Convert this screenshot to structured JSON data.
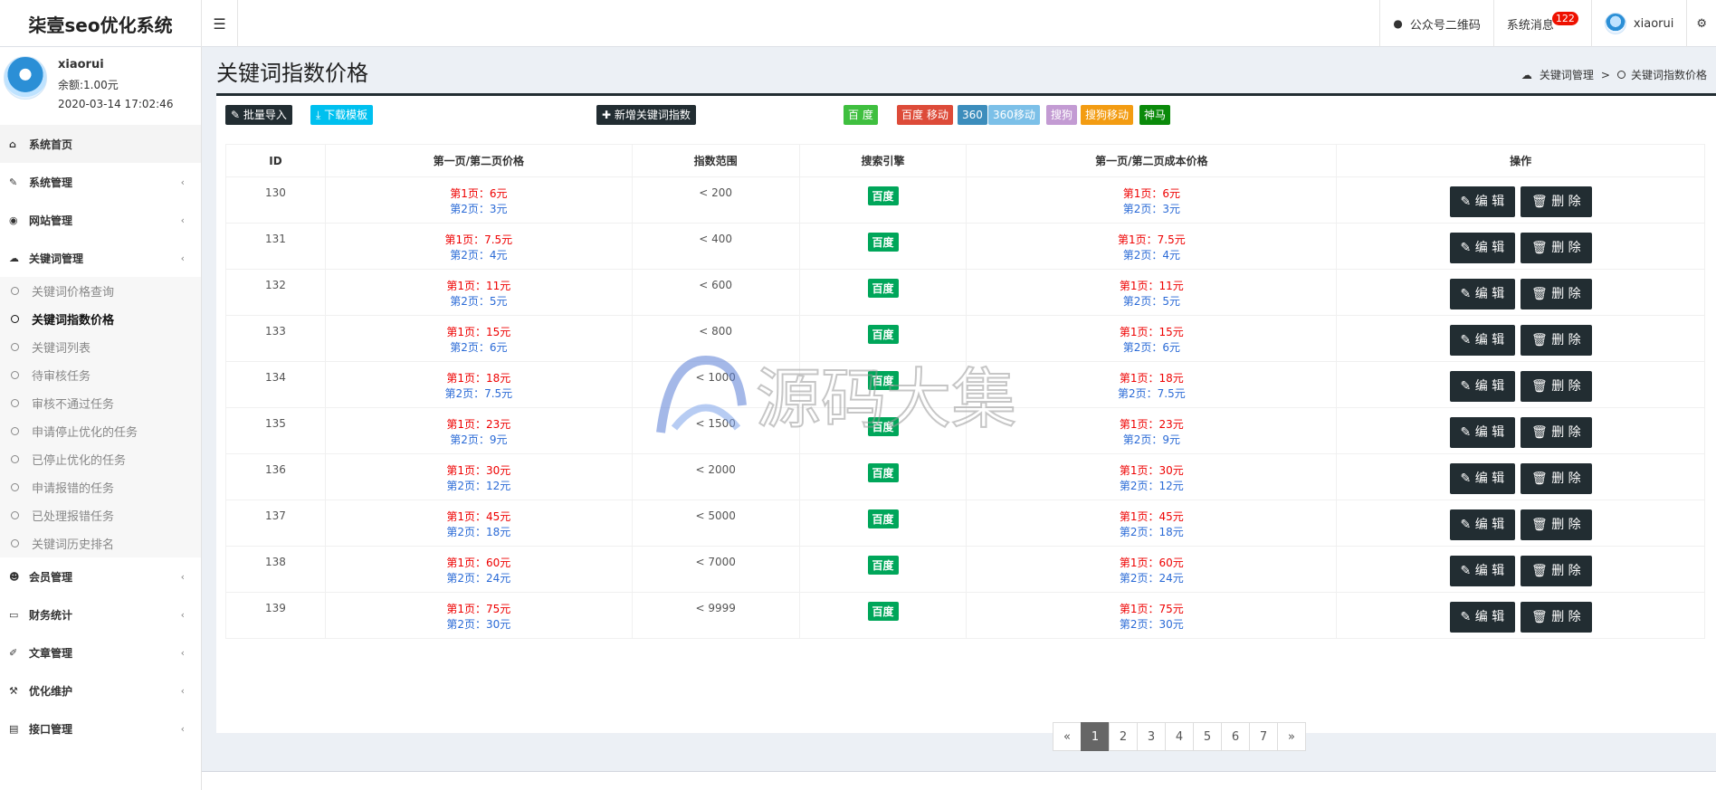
{
  "header": {
    "logo": "柒壹seo优化系统",
    "toggle_icon": "☰",
    "qr_label": "公众号二维码",
    "messages_label": "系统消息",
    "messages_count": "122",
    "username": "xiaorui",
    "gear_icon": "⚙"
  },
  "user": {
    "name": "xiaorui",
    "balance": "余额:1.00元",
    "datetime": "2020-03-14 17:02:46"
  },
  "sidebar": {
    "items": [
      {
        "label": "系统首页",
        "icon": "home-icon"
      },
      {
        "label": "系统管理",
        "icon": "wrench-icon"
      },
      {
        "label": "网站管理",
        "icon": "circle-icon"
      },
      {
        "label": "关键词管理",
        "icon": "cloud-icon"
      }
    ],
    "sub_items": [
      "关键词价格查询",
      "关键词指数价格",
      "关键词列表",
      "待审核任务",
      "审核不通过任务",
      "申请停止优化的任务",
      "已停止优化的任务",
      "申请报错的任务",
      "已处理报错任务",
      "关键词历史排名"
    ],
    "items_after": [
      {
        "label": "会员管理",
        "icon": "users-icon"
      },
      {
        "label": "财务统计",
        "icon": "card-icon"
      },
      {
        "label": "文章管理",
        "icon": "edit-icon"
      },
      {
        "label": "优化维护",
        "icon": "hammer-icon"
      },
      {
        "label": "接口管理",
        "icon": "book-icon"
      }
    ]
  },
  "page": {
    "title": "关键词指数价格",
    "breadcrumb_parent": "关键词管理",
    "breadcrumb_sep": ">",
    "breadcrumb_current": "关键词指数价格"
  },
  "toolbar": {
    "import_label": "批量导入",
    "download_label": "下载模板",
    "add_label": "新增关键词指数",
    "engines": [
      {
        "label": "百 度",
        "color": "#3fbf3f"
      },
      {
        "label": "百度 移动",
        "color": "#dd4b39"
      },
      {
        "label": "360",
        "color": "#3c8dbc"
      },
      {
        "label": "360移动",
        "color": "#7cc0e8"
      },
      {
        "label": "搜狗",
        "color": "#c39bd3"
      },
      {
        "label": "搜狗移动",
        "color": "#f39c12"
      },
      {
        "label": "神马",
        "color": "#0a8a0a"
      }
    ]
  },
  "table": {
    "headers": [
      "ID",
      "第一页/第二页价格",
      "指数范围",
      "搜索引擎",
      "第一页/第二页成本价格",
      "操作"
    ],
    "edit_label": "编 辑",
    "delete_label": "删 除",
    "rows": [
      {
        "id": "130",
        "p1": "第1页：6元",
        "p2": "第2页：3元",
        "range": "< 200",
        "engine": "百度",
        "c1": "第1页：6元",
        "c2": "第2页：3元"
      },
      {
        "id": "131",
        "p1": "第1页：7.5元",
        "p2": "第2页：4元",
        "range": "< 400",
        "engine": "百度",
        "c1": "第1页：7.5元",
        "c2": "第2页：4元"
      },
      {
        "id": "132",
        "p1": "第1页：11元",
        "p2": "第2页：5元",
        "range": "< 600",
        "engine": "百度",
        "c1": "第1页：11元",
        "c2": "第2页：5元"
      },
      {
        "id": "133",
        "p1": "第1页：15元",
        "p2": "第2页：6元",
        "range": "< 800",
        "engine": "百度",
        "c1": "第1页：15元",
        "c2": "第2页：6元"
      },
      {
        "id": "134",
        "p1": "第1页：18元",
        "p2": "第2页：7.5元",
        "range": "< 1000",
        "engine": "百度",
        "c1": "第1页：18元",
        "c2": "第2页：7.5元"
      },
      {
        "id": "135",
        "p1": "第1页：23元",
        "p2": "第2页：9元",
        "range": "< 1500",
        "engine": "百度",
        "c1": "第1页：23元",
        "c2": "第2页：9元"
      },
      {
        "id": "136",
        "p1": "第1页：30元",
        "p2": "第2页：12元",
        "range": "< 2000",
        "engine": "百度",
        "c1": "第1页：30元",
        "c2": "第2页：12元"
      },
      {
        "id": "137",
        "p1": "第1页：45元",
        "p2": "第2页：18元",
        "range": "< 5000",
        "engine": "百度",
        "c1": "第1页：45元",
        "c2": "第2页：18元"
      },
      {
        "id": "138",
        "p1": "第1页：60元",
        "p2": "第2页：24元",
        "range": "< 7000",
        "engine": "百度",
        "c1": "第1页：60元",
        "c2": "第2页：24元"
      },
      {
        "id": "139",
        "p1": "第1页：75元",
        "p2": "第2页：30元",
        "range": "< 9999",
        "engine": "百度",
        "c1": "第1页：75元",
        "c2": "第2页：30元"
      }
    ]
  },
  "pagination": {
    "prev": "«",
    "pages": [
      "1",
      "2",
      "3",
      "4",
      "5",
      "6",
      "7"
    ],
    "next": "»",
    "active": "1"
  },
  "watermark": {
    "text": "源码大集"
  },
  "colors": {
    "sidebar_dark": "#222d32",
    "price_red": "#e00",
    "price_blue": "#2a6ad6",
    "engine_green": "#00a65a"
  }
}
